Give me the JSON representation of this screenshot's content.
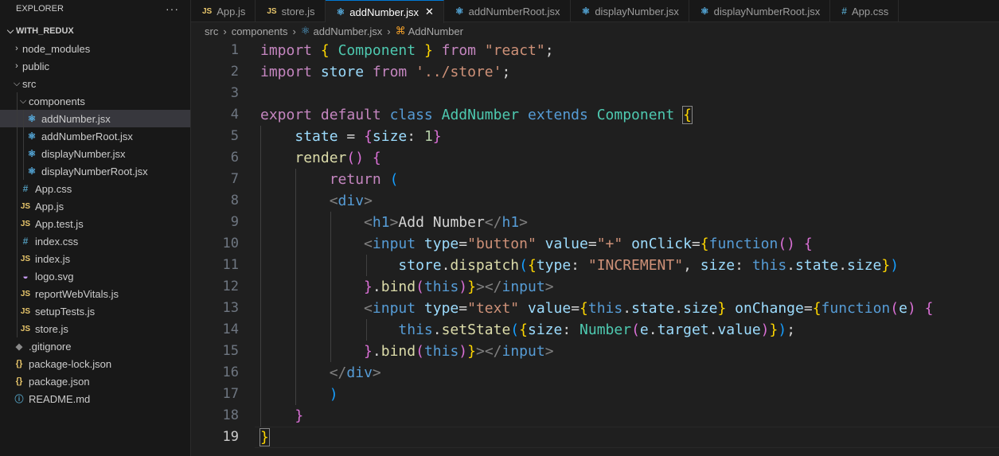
{
  "explorer": {
    "title": "EXPLORER",
    "more": "···",
    "root": "WITH_REDUX",
    "items": [
      {
        "label": "node_modules",
        "type": "folder",
        "expanded": false,
        "depth": 1
      },
      {
        "label": "public",
        "type": "folder",
        "expanded": false,
        "depth": 1
      },
      {
        "label": "src",
        "type": "folder",
        "expanded": true,
        "depth": 1
      },
      {
        "label": "components",
        "type": "folder",
        "expanded": true,
        "depth": 2
      },
      {
        "label": "addNumber.jsx",
        "type": "react",
        "depth": 3,
        "selected": true
      },
      {
        "label": "addNumberRoot.jsx",
        "type": "react",
        "depth": 3
      },
      {
        "label": "displayNumber.jsx",
        "type": "react",
        "depth": 3
      },
      {
        "label": "displayNumberRoot.jsx",
        "type": "react",
        "depth": 3
      },
      {
        "label": "App.css",
        "type": "css",
        "depth": 2
      },
      {
        "label": "App.js",
        "type": "js",
        "depth": 2
      },
      {
        "label": "App.test.js",
        "type": "js",
        "depth": 2
      },
      {
        "label": "index.css",
        "type": "css",
        "depth": 2
      },
      {
        "label": "index.js",
        "type": "js",
        "depth": 2
      },
      {
        "label": "logo.svg",
        "type": "svg",
        "depth": 2
      },
      {
        "label": "reportWebVitals.js",
        "type": "js",
        "depth": 2
      },
      {
        "label": "setupTests.js",
        "type": "js",
        "depth": 2
      },
      {
        "label": "store.js",
        "type": "js",
        "depth": 2
      },
      {
        "label": ".gitignore",
        "type": "git",
        "depth": 1
      },
      {
        "label": "package-lock.json",
        "type": "json",
        "depth": 1
      },
      {
        "label": "package.json",
        "type": "json",
        "depth": 1
      },
      {
        "label": "README.md",
        "type": "md",
        "depth": 1
      }
    ]
  },
  "tabs": [
    {
      "label": "App.js",
      "type": "js",
      "active": false
    },
    {
      "label": "store.js",
      "type": "js",
      "active": false
    },
    {
      "label": "addNumber.jsx",
      "type": "react",
      "active": true
    },
    {
      "label": "addNumberRoot.jsx",
      "type": "react",
      "active": false
    },
    {
      "label": "displayNumber.jsx",
      "type": "react",
      "active": false
    },
    {
      "label": "displayNumberRoot.jsx",
      "type": "react",
      "active": false
    },
    {
      "label": "App.css",
      "type": "css",
      "active": false
    }
  ],
  "breadcrumb": {
    "parts": [
      "src",
      "components",
      "addNumber.jsx",
      "AddNumber"
    ]
  },
  "editor": {
    "current_line": 19,
    "lines": [
      [
        [
          "kw",
          "import"
        ],
        [
          "plain",
          " "
        ],
        [
          "b1",
          "{"
        ],
        [
          "plain",
          " "
        ],
        [
          "cls",
          "Component"
        ],
        [
          "plain",
          " "
        ],
        [
          "b1",
          "}"
        ],
        [
          "plain",
          " "
        ],
        [
          "kw",
          "from"
        ],
        [
          "plain",
          " "
        ],
        [
          "str",
          "\"react\""
        ],
        [
          "plain",
          ";"
        ]
      ],
      [
        [
          "kw",
          "import"
        ],
        [
          "plain",
          " "
        ],
        [
          "var",
          "store"
        ],
        [
          "plain",
          " "
        ],
        [
          "kw",
          "from"
        ],
        [
          "plain",
          " "
        ],
        [
          "str",
          "'../store'"
        ],
        [
          "plain",
          ";"
        ]
      ],
      [],
      [
        [
          "kw",
          "export"
        ],
        [
          "plain",
          " "
        ],
        [
          "kw",
          "default"
        ],
        [
          "plain",
          " "
        ],
        [
          "kb",
          "class"
        ],
        [
          "plain",
          " "
        ],
        [
          "cls",
          "AddNumber"
        ],
        [
          "plain",
          " "
        ],
        [
          "kb",
          "extends"
        ],
        [
          "plain",
          " "
        ],
        [
          "cls",
          "Component"
        ],
        [
          "plain",
          " "
        ],
        [
          "b1 bhl",
          "{"
        ]
      ],
      [
        [
          "plain",
          "    "
        ],
        [
          "var",
          "state"
        ],
        [
          "plain",
          " = "
        ],
        [
          "b2",
          "{"
        ],
        [
          "var",
          "size"
        ],
        [
          "plain",
          ": "
        ],
        [
          "num",
          "1"
        ],
        [
          "b2",
          "}"
        ]
      ],
      [
        [
          "plain",
          "    "
        ],
        [
          "fn",
          "render"
        ],
        [
          "b2",
          "()"
        ],
        [
          "plain",
          " "
        ],
        [
          "b2",
          "{"
        ]
      ],
      [
        [
          "plain",
          "        "
        ],
        [
          "kw",
          "return"
        ],
        [
          "plain",
          " "
        ],
        [
          "b3",
          "("
        ]
      ],
      [
        [
          "plain",
          "        "
        ],
        [
          "tagb",
          "<"
        ],
        [
          "tag",
          "div"
        ],
        [
          "tagb",
          ">"
        ]
      ],
      [
        [
          "plain",
          "            "
        ],
        [
          "tagb",
          "<"
        ],
        [
          "tag",
          "h1"
        ],
        [
          "tagb",
          ">"
        ],
        [
          "plain",
          "Add Number"
        ],
        [
          "tagb",
          "</"
        ],
        [
          "tag",
          "h1"
        ],
        [
          "tagb",
          ">"
        ]
      ],
      [
        [
          "plain",
          "            "
        ],
        [
          "tagb",
          "<"
        ],
        [
          "tag",
          "input"
        ],
        [
          "plain",
          " "
        ],
        [
          "attr",
          "type"
        ],
        [
          "plain",
          "="
        ],
        [
          "str",
          "\"button\""
        ],
        [
          "plain",
          " "
        ],
        [
          "attr",
          "value"
        ],
        [
          "plain",
          "="
        ],
        [
          "str",
          "\"+\""
        ],
        [
          "plain",
          " "
        ],
        [
          "attr",
          "onClick"
        ],
        [
          "plain",
          "="
        ],
        [
          "b1",
          "{"
        ],
        [
          "kb",
          "function"
        ],
        [
          "b2",
          "()"
        ],
        [
          "plain",
          " "
        ],
        [
          "b2",
          "{"
        ]
      ],
      [
        [
          "plain",
          "                "
        ],
        [
          "var",
          "store"
        ],
        [
          "plain",
          "."
        ],
        [
          "fn",
          "dispatch"
        ],
        [
          "b3",
          "("
        ],
        [
          "b1",
          "{"
        ],
        [
          "var",
          "type"
        ],
        [
          "plain",
          ": "
        ],
        [
          "str",
          "\"INCREMENT\""
        ],
        [
          "plain",
          ", "
        ],
        [
          "var",
          "size"
        ],
        [
          "plain",
          ": "
        ],
        [
          "kb",
          "this"
        ],
        [
          "plain",
          "."
        ],
        [
          "var",
          "state"
        ],
        [
          "plain",
          "."
        ],
        [
          "var",
          "size"
        ],
        [
          "b1",
          "}"
        ],
        [
          "b3",
          ")"
        ]
      ],
      [
        [
          "plain",
          "            "
        ],
        [
          "b2",
          "}"
        ],
        [
          "plain",
          "."
        ],
        [
          "fn",
          "bind"
        ],
        [
          "b2",
          "("
        ],
        [
          "kb",
          "this"
        ],
        [
          "b2",
          ")"
        ],
        [
          "b1",
          "}"
        ],
        [
          "tagb",
          "></"
        ],
        [
          "tag",
          "input"
        ],
        [
          "tagb",
          ">"
        ]
      ],
      [
        [
          "plain",
          "            "
        ],
        [
          "tagb",
          "<"
        ],
        [
          "tag",
          "input"
        ],
        [
          "plain",
          " "
        ],
        [
          "attr",
          "type"
        ],
        [
          "plain",
          "="
        ],
        [
          "str",
          "\"text\""
        ],
        [
          "plain",
          " "
        ],
        [
          "attr",
          "value"
        ],
        [
          "plain",
          "="
        ],
        [
          "b1",
          "{"
        ],
        [
          "kb",
          "this"
        ],
        [
          "plain",
          "."
        ],
        [
          "var",
          "state"
        ],
        [
          "plain",
          "."
        ],
        [
          "var",
          "size"
        ],
        [
          "b1",
          "}"
        ],
        [
          "plain",
          " "
        ],
        [
          "attr",
          "onChange"
        ],
        [
          "plain",
          "="
        ],
        [
          "b1",
          "{"
        ],
        [
          "kb",
          "function"
        ],
        [
          "b2",
          "("
        ],
        [
          "var",
          "e"
        ],
        [
          "b2",
          ")"
        ],
        [
          "plain",
          " "
        ],
        [
          "b2",
          "{"
        ]
      ],
      [
        [
          "plain",
          "                "
        ],
        [
          "kb",
          "this"
        ],
        [
          "plain",
          "."
        ],
        [
          "fn",
          "setState"
        ],
        [
          "b3",
          "("
        ],
        [
          "b1",
          "{"
        ],
        [
          "var",
          "size"
        ],
        [
          "plain",
          ": "
        ],
        [
          "cls",
          "Number"
        ],
        [
          "b2",
          "("
        ],
        [
          "var",
          "e"
        ],
        [
          "plain",
          "."
        ],
        [
          "var",
          "target"
        ],
        [
          "plain",
          "."
        ],
        [
          "var",
          "value"
        ],
        [
          "b2",
          ")"
        ],
        [
          "b1",
          "}"
        ],
        [
          "b3",
          ")"
        ],
        [
          "plain",
          ";"
        ]
      ],
      [
        [
          "plain",
          "            "
        ],
        [
          "b2",
          "}"
        ],
        [
          "plain",
          "."
        ],
        [
          "fn",
          "bind"
        ],
        [
          "b2",
          "("
        ],
        [
          "kb",
          "this"
        ],
        [
          "b2",
          ")"
        ],
        [
          "b1",
          "}"
        ],
        [
          "tagb",
          "></"
        ],
        [
          "tag",
          "input"
        ],
        [
          "tagb",
          ">"
        ]
      ],
      [
        [
          "plain",
          "        "
        ],
        [
          "tagb",
          "</"
        ],
        [
          "tag",
          "div"
        ],
        [
          "tagb",
          ">"
        ]
      ],
      [
        [
          "plain",
          "        "
        ],
        [
          "b3",
          ")"
        ]
      ],
      [
        [
          "plain",
          "    "
        ],
        [
          "b2",
          "}"
        ]
      ],
      [
        [
          "b1 bhl",
          "}"
        ]
      ]
    ]
  }
}
